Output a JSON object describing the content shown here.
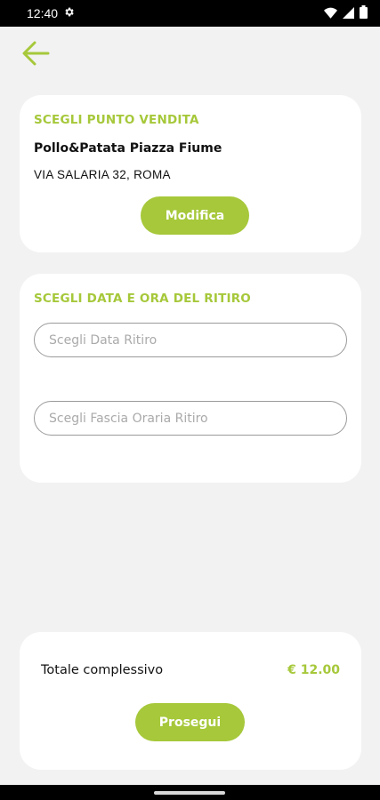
{
  "status_bar": {
    "time": "12:40"
  },
  "store_card": {
    "title": "SCEGLI PUNTO VENDITA",
    "store_name": "Pollo&Patata Piazza Fiume",
    "address": "VIA SALARIA 32, ROMA",
    "edit_label": "Modifica"
  },
  "pickup_card": {
    "title": "SCEGLI DATA E ORA DEL RITIRO",
    "date_placeholder": "Scegli Data Ritiro",
    "slot_placeholder": "Scegli Fascia Oraria Ritiro"
  },
  "total_card": {
    "label": "Totale complessivo",
    "value": "€ 12.00",
    "continue_label": "Prosegui"
  },
  "colors": {
    "accent": "#a6c83a",
    "background": "#f2f2f2",
    "card": "#ffffff"
  },
  "icons": [
    "settings-icon",
    "wifi-icon",
    "signal-icon",
    "battery-icon",
    "back-arrow-icon"
  ]
}
